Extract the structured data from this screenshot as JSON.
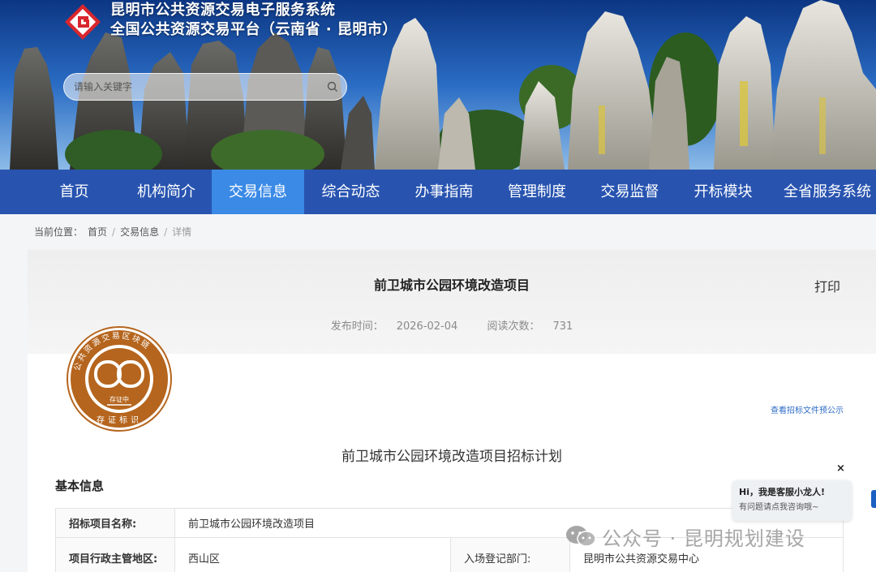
{
  "header": {
    "title_line1": "昆明市公共资源交易电子服务系统",
    "title_line2": "全国公共资源交易平台（云南省 · 昆明市）",
    "search": {
      "placeholder": "请输入关键字"
    }
  },
  "nav": {
    "items": [
      {
        "label": "首页"
      },
      {
        "label": "机构简介"
      },
      {
        "label": "交易信息",
        "active": true
      },
      {
        "label": "综合动态"
      },
      {
        "label": "办事指南"
      },
      {
        "label": "管理制度"
      },
      {
        "label": "交易监督"
      },
      {
        "label": "开标模块"
      },
      {
        "label": "全省服务系统"
      }
    ]
  },
  "breadcrumb": {
    "prefix": "当前位置：",
    "items": [
      "首页",
      "交易信息",
      "详情"
    ]
  },
  "article": {
    "title": "前卫城市公园环境改造项目",
    "print_label": "打印",
    "publish_label": "发布时间：",
    "publish_date": "2026-02-04",
    "views_label": "阅读次数：",
    "views": "731",
    "preview_link": "查看招标文件预公示",
    "plan_title": "前卫城市公园环境改造项目招标计划",
    "section_title": "基本信息",
    "stamp": {
      "ring_text": "公共资源交易区块链",
      "center_text": "存证中",
      "bottom_text": "存证标识"
    }
  },
  "info_table": {
    "rows": [
      {
        "label": "招标项目名称:",
        "value": "前卫城市公园环境改造项目"
      },
      {
        "label": "项目行政主管地区:",
        "value": "西山区",
        "label2": "入场登记部门:",
        "value2": "昆明市公共资源交易中心"
      }
    ]
  },
  "chat": {
    "greeting": "Hi，我是客服小龙人!",
    "sub": "有问题请点我咨询哦~",
    "close": "×"
  },
  "watermark": {
    "text": "公众号 · 昆明规划建设"
  },
  "colors": {
    "nav_bg": "#2854b0",
    "nav_active": "#3a8ae6",
    "link": "#2d6cc6",
    "stamp": "#b5651d"
  }
}
